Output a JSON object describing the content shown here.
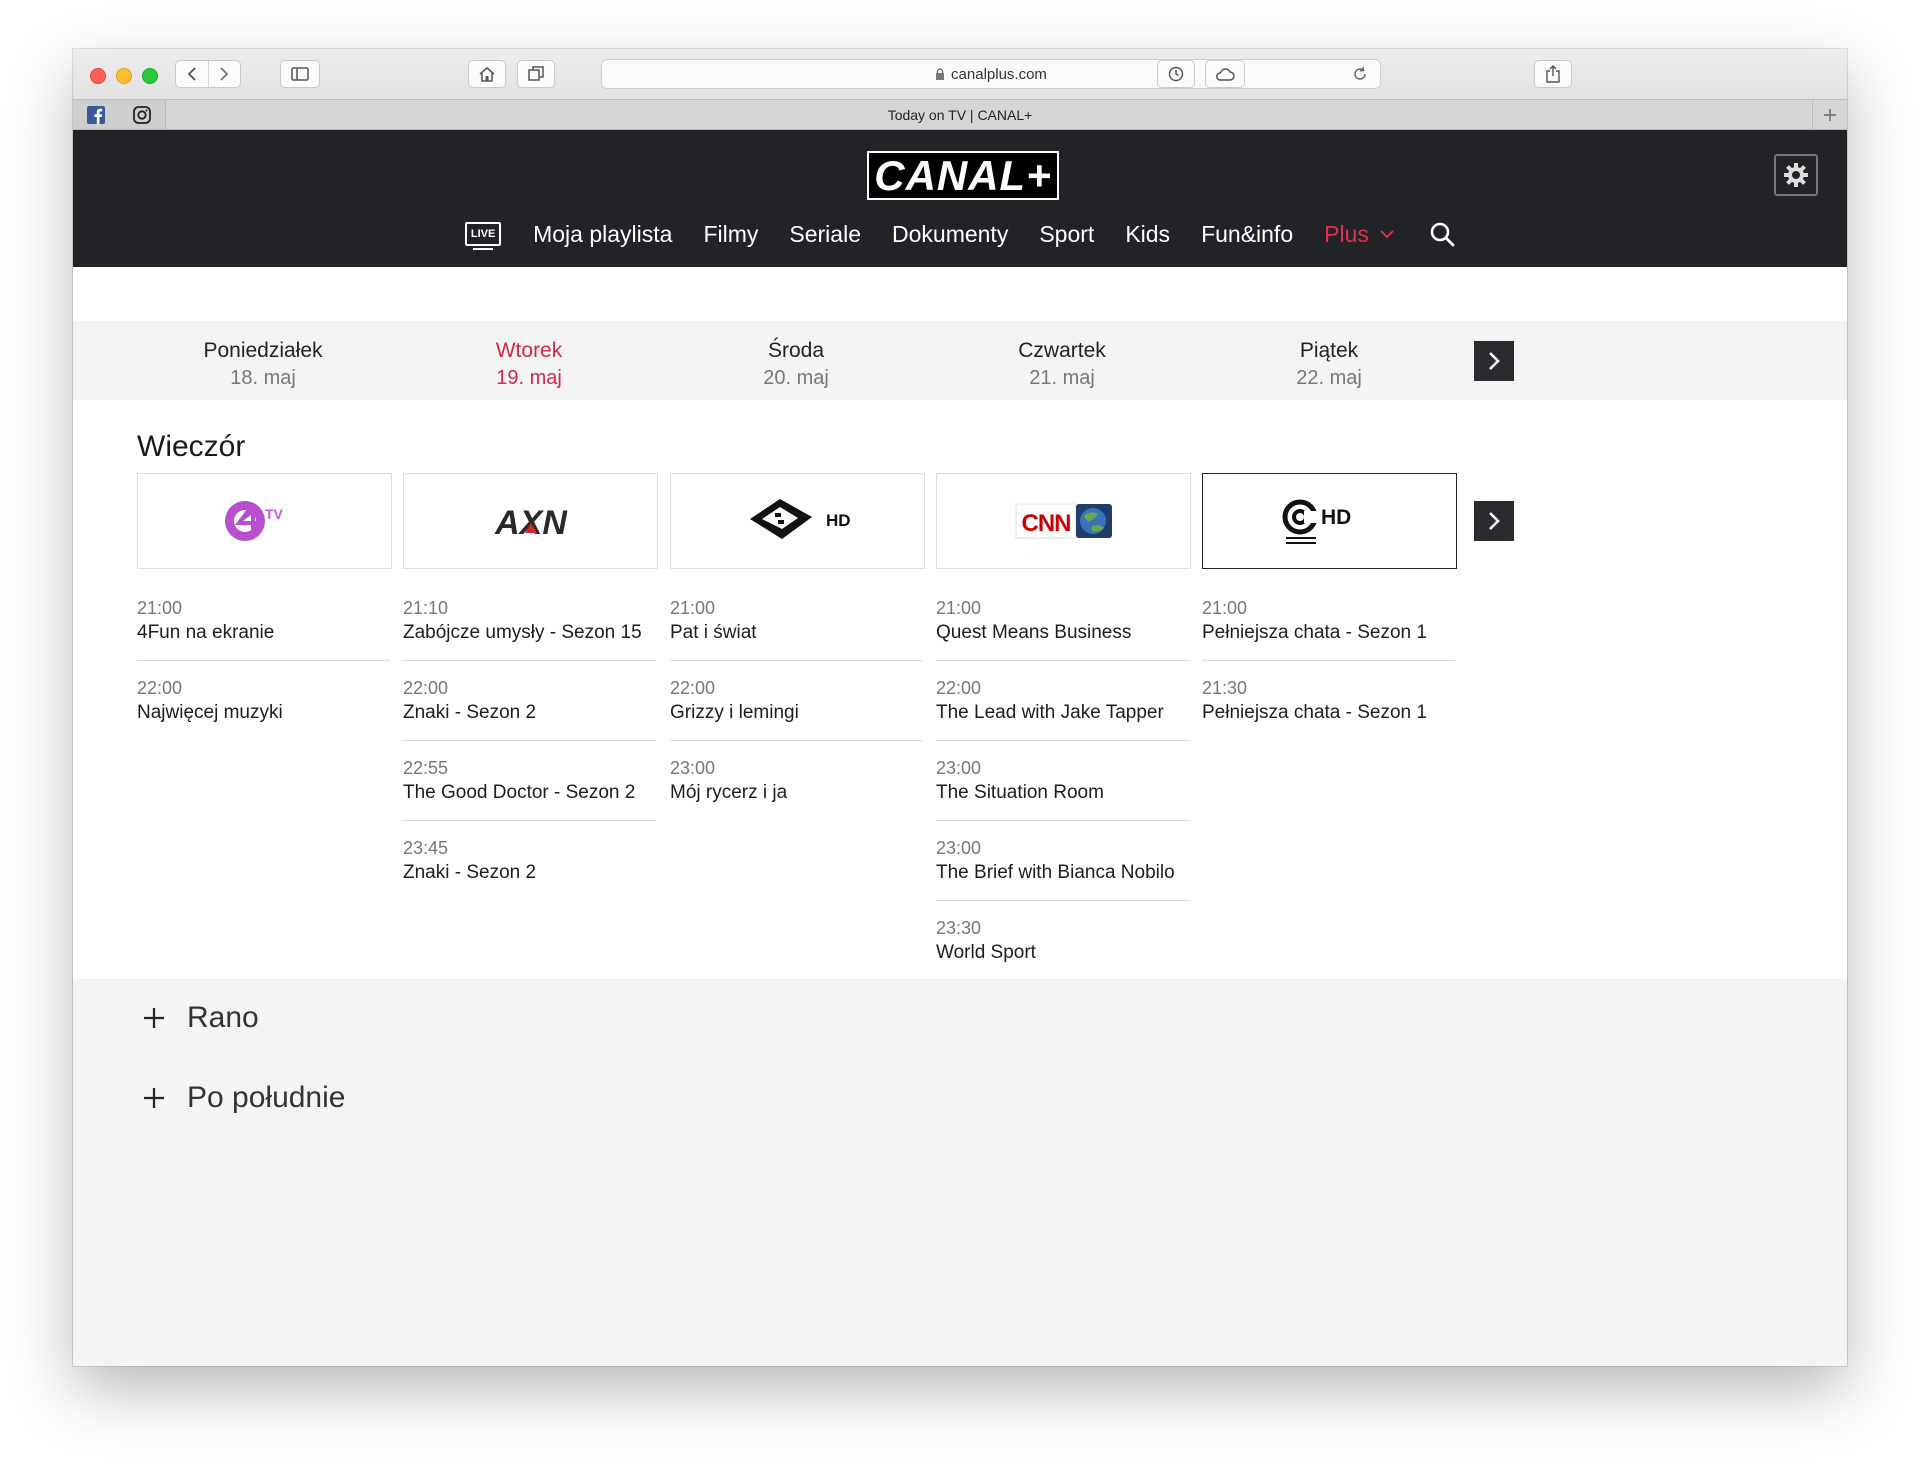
{
  "browser": {
    "url": "canalplus.com",
    "tab_title": "Today on TV | CANAL+"
  },
  "header": {
    "logo_text": "CANAL+",
    "live_badge": "LIVE",
    "nav": [
      {
        "label": "Moja playlista"
      },
      {
        "label": "Filmy"
      },
      {
        "label": "Seriale"
      },
      {
        "label": "Dokumenty"
      },
      {
        "label": "Sport"
      },
      {
        "label": "Kids"
      },
      {
        "label": "Fun&info"
      },
      {
        "label": "Plus"
      }
    ],
    "accent_color": "#e62e4d"
  },
  "days": [
    {
      "name": "Poniedziałek",
      "date": "18. maj"
    },
    {
      "name": "Wtorek",
      "date": "19. maj",
      "active": true
    },
    {
      "name": "Środa",
      "date": "20. maj"
    },
    {
      "name": "Czwartek",
      "date": "21. maj"
    },
    {
      "name": "Piątek",
      "date": "22. maj"
    }
  ],
  "schedule": {
    "section_title": "Wieczór",
    "channels": [
      {
        "logo": "4FunTV",
        "logo_label": "TV",
        "programs": [
          {
            "time": "21:00",
            "title": "4Fun na ekranie"
          },
          {
            "time": "22:00",
            "title": "Najwięcej muzyki"
          }
        ]
      },
      {
        "logo": "AXN",
        "logo_label": "AXN",
        "programs": [
          {
            "time": "21:10",
            "title": "Zabójcze umysły - Sezon 15"
          },
          {
            "time": "22:00",
            "title": "Znaki - Sezon 2"
          },
          {
            "time": "22:55",
            "title": "The Good Doctor - Sezon 2"
          },
          {
            "time": "23:45",
            "title": "Znaki - Sezon 2"
          }
        ]
      },
      {
        "logo": "Boomerang HD",
        "logo_label": "HD",
        "programs": [
          {
            "time": "21:00",
            "title": "Pat i świat"
          },
          {
            "time": "22:00",
            "title": "Grizzy i lemingi"
          },
          {
            "time": "23:00",
            "title": "Mój rycerz i ja"
          }
        ]
      },
      {
        "logo": "CNN",
        "logo_label": "CNN",
        "programs": [
          {
            "time": "21:00",
            "title": "Quest Means Business"
          },
          {
            "time": "22:00",
            "title": "The Lead with Jake Tapper"
          },
          {
            "time": "23:00",
            "title": "The Situation Room"
          },
          {
            "time": "23:00",
            "title": "The Brief with Bianca Nobilo"
          },
          {
            "time": "23:30",
            "title": "World Sport"
          }
        ]
      },
      {
        "logo": "Comedy Central HD",
        "logo_label": "HD",
        "programs": [
          {
            "time": "21:00",
            "title": "Pełniejsza chata - Sezon 1"
          },
          {
            "time": "21:30",
            "title": "Pełniejsza chata - Sezon 1"
          }
        ]
      }
    ]
  },
  "collapsed_sections": [
    {
      "label": "Rano"
    },
    {
      "label": "Po południe"
    }
  ]
}
